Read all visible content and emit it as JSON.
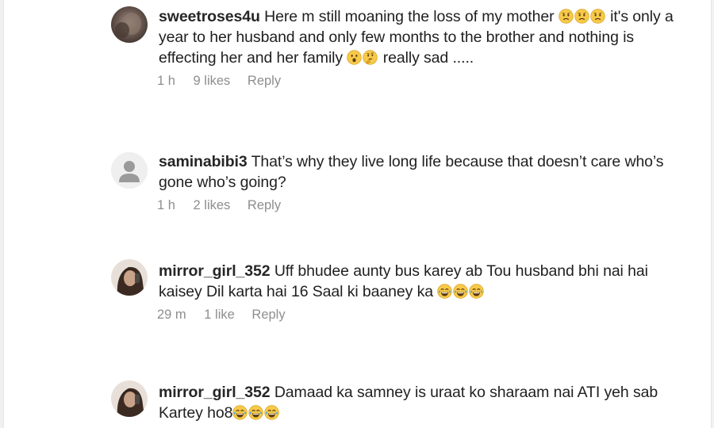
{
  "comments": [
    {
      "username": "sweetroses4u",
      "text_before": "Here m still moaning the loss of my mother",
      "emojis_1": [
        "sad-face",
        "sad-face",
        "sad-face"
      ],
      "text_mid": "it's only a year to her husband and only few months to the brother and nothing is effecting her and her family",
      "emojis_2": [
        "surprised-face",
        "thinking-face"
      ],
      "text_after": "really sad .....",
      "time": "1 h",
      "likes": "9 likes",
      "reply": "Reply"
    },
    {
      "username": "saminabibi3",
      "text_before": "That’s why they live long life because that doesn’t care who’s gone who’s going?",
      "time": "1 h",
      "likes": "2 likes",
      "reply": "Reply"
    },
    {
      "username": "mirror_girl_352",
      "text_before": "Uff bhudee aunty bus karey ab Tou husband bhi nai hai kaisey Dil karta hai 16 Saal ki baaney ka",
      "emojis_1": [
        "laughing-face",
        "laughing-face",
        "laughing-face"
      ],
      "time": "29 m",
      "likes": "1 like",
      "reply": "Reply"
    },
    {
      "username": "mirror_girl_352",
      "text_before": "Damaad ka samney is uraat ko sharaam nai ATI yeh sab Kartey ho8",
      "emojis_1": [
        "laughing-face",
        "laughing-face",
        "laughing-face"
      ]
    }
  ],
  "colors": {
    "text": "#262626",
    "meta": "#8e8e8e",
    "emoji_yellow": "#f7c948",
    "default_avatar_bg": "#dbdbdb"
  }
}
